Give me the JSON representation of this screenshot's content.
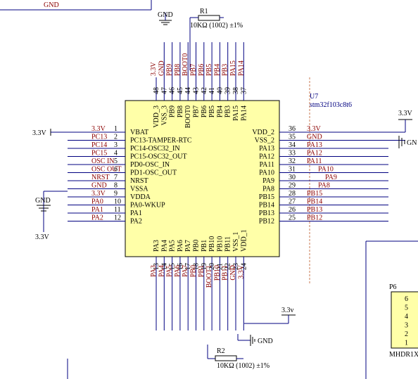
{
  "chip": {
    "ref": "U7",
    "part": "stm32f103c8t6",
    "fill": "#ffffa8",
    "border": "#000000",
    "left_pins": [
      {
        "num": "1",
        "name": "VBAT",
        "net": "3.3V"
      },
      {
        "num": "2",
        "name": "PC13-TAMPER-RTC",
        "net": "PC13"
      },
      {
        "num": "3",
        "name": "PC14-OSC32_IN",
        "net": "PC14"
      },
      {
        "num": "4",
        "name": "PC15-OSC32_OUT",
        "net": "PC15"
      },
      {
        "num": "5",
        "name": "PD0-OSC_IN",
        "net": "OSC IN"
      },
      {
        "num": "6",
        "name": "PD1-OSC_OUT",
        "net": "OSC OUT"
      },
      {
        "num": "7",
        "name": "NRST",
        "net": "NRST"
      },
      {
        "num": "8",
        "name": "VSSA",
        "net": "GND"
      },
      {
        "num": "9",
        "name": "VDDA",
        "net": "3.3V"
      },
      {
        "num": "10",
        "name": "PA0-WKUP",
        "net": "PA0"
      },
      {
        "num": "11",
        "name": "PA1",
        "net": "PA1"
      },
      {
        "num": "12",
        "name": "PA2",
        "net": "PA2"
      }
    ],
    "right_pins": [
      {
        "num": "36",
        "name": "VDD_2",
        "net": "3.3V"
      },
      {
        "num": "35",
        "name": "VSS_2",
        "net": "GND"
      },
      {
        "num": "34",
        "name": "PA13",
        "net": "PA13"
      },
      {
        "num": "33",
        "name": "PA12",
        "net": "PA12"
      },
      {
        "num": "32",
        "name": "PA11",
        "net": "PA11"
      },
      {
        "num": "31",
        "name": "PA10",
        "net": "PA10"
      },
      {
        "num": "30",
        "name": "PA9",
        "net": "PA9"
      },
      {
        "num": "29",
        "name": "PA8",
        "net": "PA8"
      },
      {
        "num": "28",
        "name": "PB15",
        "net": "PB15"
      },
      {
        "num": "27",
        "name": "PB14",
        "net": "PB14"
      },
      {
        "num": "26",
        "name": "PB13",
        "net": "PB13"
      },
      {
        "num": "25",
        "name": "PB12",
        "net": "PB12"
      }
    ],
    "top_pins": [
      {
        "num": "48",
        "name": "VDD_3",
        "net": "3.3V"
      },
      {
        "num": "47",
        "name": "VSS_3",
        "net": "GND"
      },
      {
        "num": "46",
        "name": "PB9",
        "net": "PB9"
      },
      {
        "num": "45",
        "name": "PB8",
        "net": "PB8"
      },
      {
        "num": "44",
        "name": "BOOT0",
        "net": "BOOT0"
      },
      {
        "num": "43",
        "name": "PB7",
        "net": "PB7"
      },
      {
        "num": "42",
        "name": "PB6",
        "net": "PB6"
      },
      {
        "num": "41",
        "name": "PB5",
        "net": "PB5"
      },
      {
        "num": "40",
        "name": "PB4",
        "net": "PB4"
      },
      {
        "num": "39",
        "name": "PB3",
        "net": "PB3"
      },
      {
        "num": "38",
        "name": "PA15",
        "net": "PA15"
      },
      {
        "num": "37",
        "name": "PA14",
        "net": "PA14"
      }
    ],
    "bottom_pins": [
      {
        "num": "13",
        "name": "PA3",
        "net": "PA3"
      },
      {
        "num": "14",
        "name": "PA4",
        "net": "PA4"
      },
      {
        "num": "15",
        "name": "PA5",
        "net": "PA5"
      },
      {
        "num": "16",
        "name": "PA6",
        "net": "PA6"
      },
      {
        "num": "17",
        "name": "PA7",
        "net": "PA7"
      },
      {
        "num": "18",
        "name": "PB0",
        "net": "PB0"
      },
      {
        "num": "19",
        "name": "PB1",
        "net": "PB1"
      },
      {
        "num": "20",
        "name": "PB10",
        "net": "BOOT1"
      },
      {
        "num": "21",
        "name": "PB10",
        "net": "PB10"
      },
      {
        "num": "22",
        "name": "PB11",
        "net": "PB11"
      },
      {
        "num": "23",
        "name": "VSS_1",
        "net": "GND"
      },
      {
        "num": "24",
        "name": "VDD_1",
        "net": "3.3V"
      }
    ]
  },
  "r1": {
    "ref": "R1",
    "value": "10KΩ (1002) ±1%"
  },
  "r2": {
    "ref": "R2",
    "value": "10KΩ (1002) ±1%"
  },
  "labels": {
    "gnd": "GND",
    "vcc_upper": "3.3V",
    "vcc_lower": "3.3v",
    "gnd_right_partial": "GN"
  },
  "header": {
    "ref": "P6",
    "name": "MHDR1X",
    "pins": [
      "6",
      "5",
      "4",
      "3",
      "2",
      "1"
    ]
  },
  "colors": {
    "wire": "#000080",
    "net_label": "#8b0000",
    "chip_fill": "#ffffa8",
    "dashed_line": "#c87850"
  }
}
